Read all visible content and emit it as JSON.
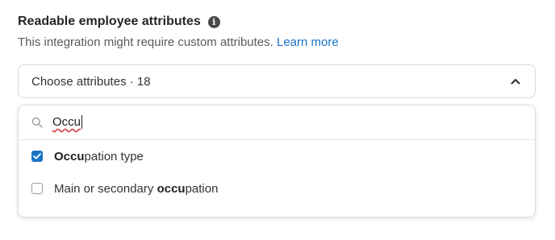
{
  "section": {
    "title": "Readable employee attributes",
    "info_icon": "info-icon",
    "subtitle": "This integration might require custom attributes.",
    "learn_more": "Learn more"
  },
  "select": {
    "label": "Choose attributes · 18",
    "icon": "chevron-up-icon"
  },
  "dropdown": {
    "search_icon": "search-icon",
    "search_value": "Occu",
    "options": [
      {
        "match": "Occu",
        "rest": "pation type",
        "prefix": "",
        "checked": true
      },
      {
        "prefix": "Main or secondary ",
        "match": "occu",
        "rest": "pation",
        "checked": false
      }
    ]
  },
  "colors": {
    "accent": "#1a73c7",
    "title": "#262626",
    "border": "#d8d8d8"
  }
}
